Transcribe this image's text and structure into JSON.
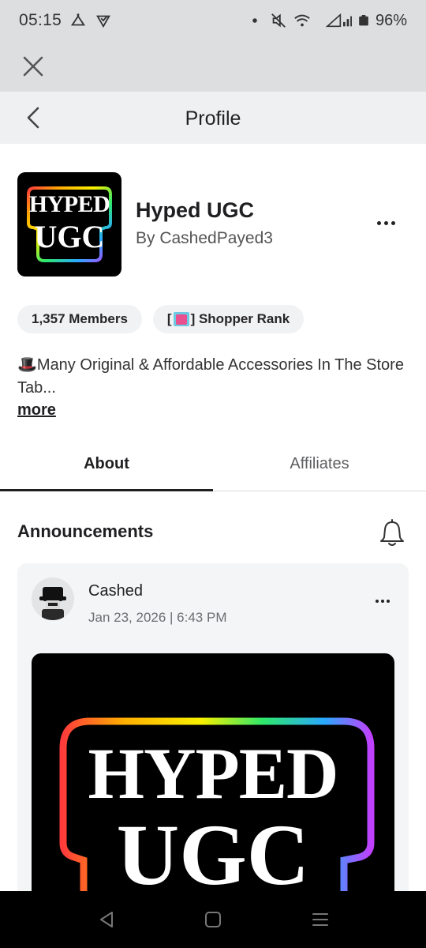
{
  "status_bar": {
    "time": "05:15",
    "battery": "96%",
    "icons": [
      "alarm-icon",
      "check-shield-icon",
      "dot-icon",
      "mute-icon",
      "wifi-icon",
      "signal-icon",
      "battery-icon"
    ]
  },
  "top_bar": {
    "close_icon": "close-icon"
  },
  "nav": {
    "title": "Profile",
    "back_icon": "chevron-left-icon"
  },
  "group": {
    "logo_text_line1": "HYPED",
    "logo_text_line2": "UGC",
    "name": "Hyped UGC",
    "owner": "By CashedPayed3",
    "members": "1,357 Members",
    "rank_prefix": "[",
    "rank_suffix": "] Shopper Rank",
    "description": "🎩Many Original & Affordable Accessories In The Store Tab...",
    "more_label": "more"
  },
  "tabs": [
    {
      "label": "About",
      "active": true
    },
    {
      "label": "Affiliates",
      "active": false
    }
  ],
  "announcements": {
    "title": "Announcements",
    "post": {
      "author": "Cashed",
      "date": "Jan 23, 2026 | 6:43 PM",
      "image_text_line1": "HYPED",
      "image_text_line2": "UGC"
    }
  },
  "colors": {
    "status_bg": "#dcdee0",
    "nav_bg": "#eef0f1",
    "card_bg": "#f4f5f6",
    "text_primary": "#1f1f22",
    "text_secondary": "#6d6e72"
  }
}
